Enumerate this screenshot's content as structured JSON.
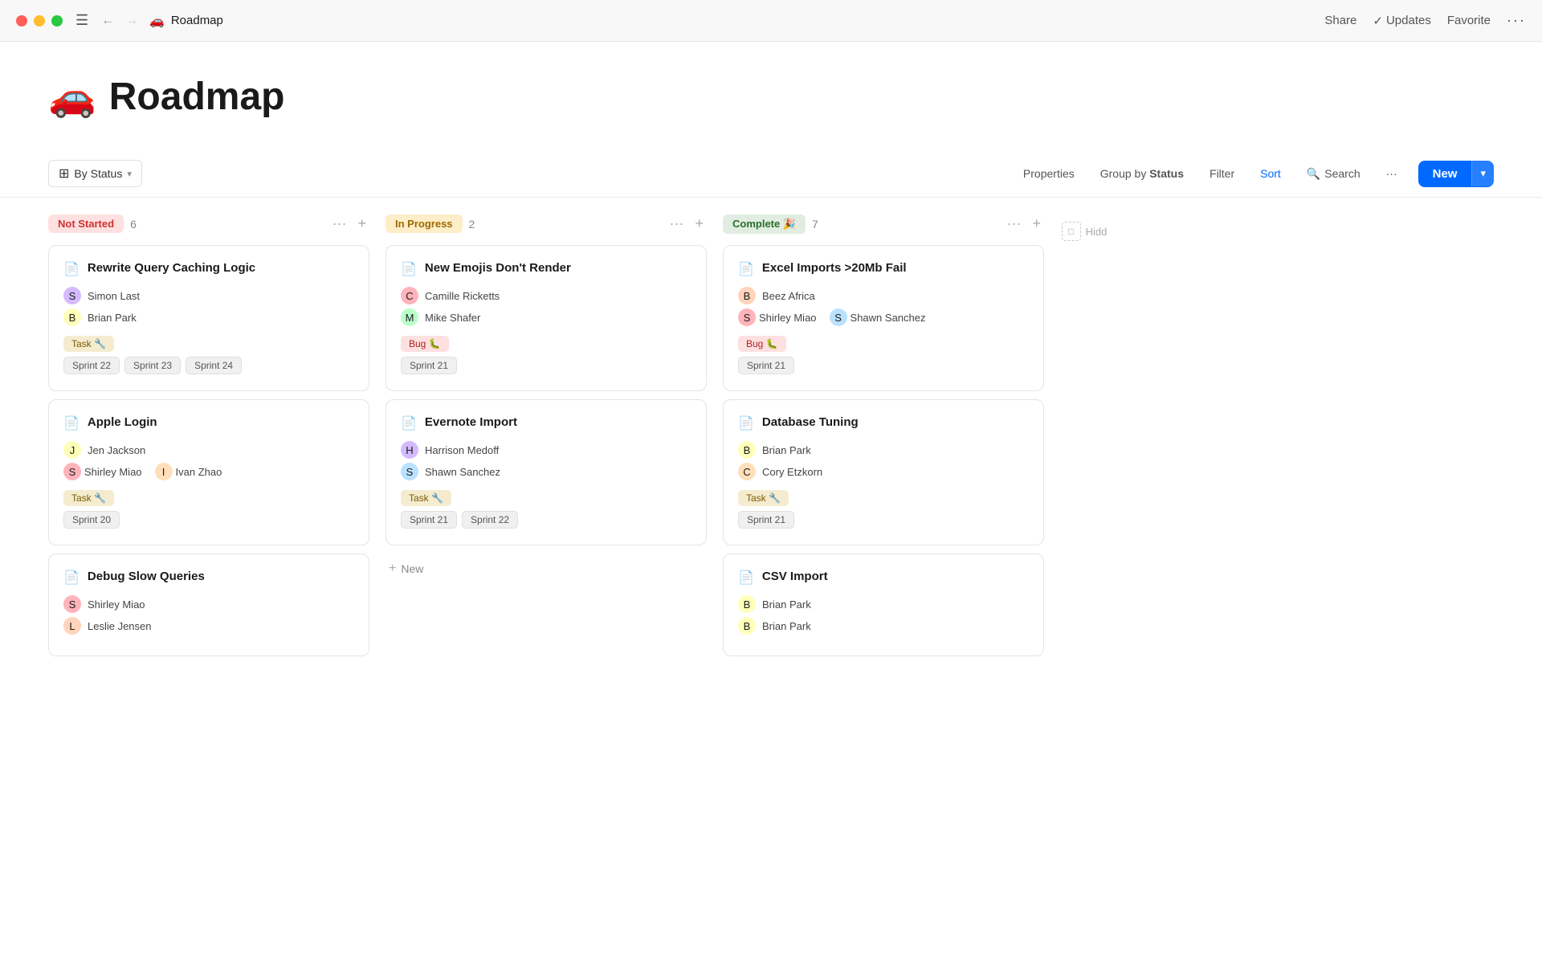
{
  "titleBar": {
    "pageTitle": "Roadmap",
    "pageEmoji": "🚗",
    "share": "Share",
    "updates": "Updates",
    "favorite": "Favorite"
  },
  "pageHeader": {
    "emoji": "🚗",
    "title": "Roadmap"
  },
  "toolbar": {
    "viewLabel": "By Status",
    "properties": "Properties",
    "groupBy": "Group by",
    "groupByValue": "Status",
    "filter": "Filter",
    "sort": "Sort",
    "search": "Search",
    "more": "···",
    "newLabel": "New"
  },
  "columns": [
    {
      "id": "not-started",
      "status": "Not Started",
      "statusClass": "status-not-started",
      "count": 6,
      "cards": [
        {
          "title": "Rewrite Query Caching Logic",
          "assignees": [
            "Simon Last",
            "Brian Park"
          ],
          "tags": [
            "Task 🔧"
          ],
          "tagTypes": [
            "task"
          ],
          "sprints": [
            "Sprint 22",
            "Sprint 23",
            "Sprint 24"
          ]
        },
        {
          "title": "Apple Login",
          "assignees": [
            "Jen Jackson",
            "Shirley Miao",
            "Ivan Zhao"
          ],
          "multiOnSecond": true,
          "tags": [
            "Task 🔧"
          ],
          "tagTypes": [
            "task"
          ],
          "sprints": [
            "Sprint 20"
          ]
        },
        {
          "title": "Debug Slow Queries",
          "assignees": [
            "Shirley Miao",
            "Leslie Jensen"
          ],
          "tags": [],
          "tagTypes": [],
          "sprints": []
        }
      ]
    },
    {
      "id": "in-progress",
      "status": "In Progress",
      "statusClass": "status-in-progress",
      "count": 2,
      "cards": [
        {
          "title": "New Emojis Don't Render",
          "assignees": [
            "Camille Ricketts",
            "Mike Shafer"
          ],
          "tags": [
            "Bug 🐛"
          ],
          "tagTypes": [
            "bug"
          ],
          "sprints": [
            "Sprint 21"
          ]
        },
        {
          "title": "Evernote Import",
          "assignees": [
            "Harrison Medoff",
            "Shawn Sanchez"
          ],
          "tags": [
            "Task 🔧"
          ],
          "tagTypes": [
            "task"
          ],
          "sprints": [
            "Sprint 21",
            "Sprint 22"
          ]
        }
      ],
      "showAddNew": true
    },
    {
      "id": "complete",
      "status": "Complete 🎉",
      "statusClass": "status-complete",
      "count": 7,
      "cards": [
        {
          "title": "Excel Imports >20Mb Fail",
          "assignees": [
            "Beez Africa",
            "Shirley Miao",
            "Shawn Sanchez"
          ],
          "multiOnSecond": true,
          "tags": [
            "Bug 🐛"
          ],
          "tagTypes": [
            "bug"
          ],
          "sprints": [
            "Sprint 21"
          ]
        },
        {
          "title": "Database Tuning",
          "assignees": [
            "Brian Park",
            "Cory Etzkorn"
          ],
          "tags": [
            "Task 🔧"
          ],
          "tagTypes": [
            "task"
          ],
          "sprints": [
            "Sprint 21"
          ]
        },
        {
          "title": "CSV Import",
          "assignees": [
            "Brian Park",
            "Brian Park"
          ],
          "tags": [],
          "tagTypes": [],
          "sprints": []
        }
      ]
    }
  ],
  "hiddenColumn": {
    "label": "Hidden"
  },
  "addNewLabel": "+ New"
}
